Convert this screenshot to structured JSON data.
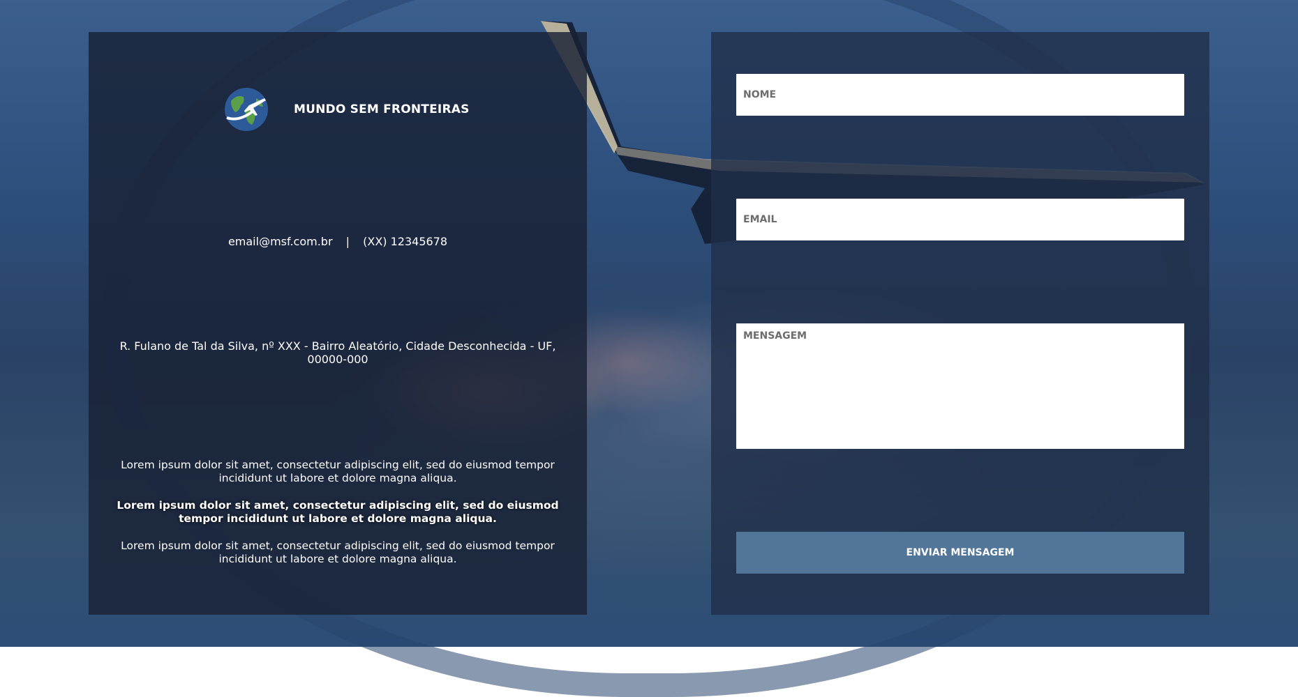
{
  "brand": {
    "name": "MUNDO SEM FRONTEIRAS",
    "logo_icon": "globe-airplane-icon"
  },
  "contact": {
    "email": "email@msf.com.br",
    "separator": "|",
    "phone": "(XX) 12345678",
    "address": "R. Fulano de Tal da Silva, nº XXX - Bairro Aleatório, Cidade Desconhecida - UF, 00000-000"
  },
  "about": {
    "paragraphs": [
      "Lorem ipsum dolor sit amet, consectetur adipiscing elit, sed do eiusmod tempor incididunt ut labore et dolore magna aliqua.",
      "Lorem ipsum dolor sit amet, consectetur adipiscing elit, sed do eiusmod tempor incididunt ut labore et dolore magna aliqua.",
      "Lorem ipsum dolor sit amet, consectetur adipiscing elit, sed do eiusmod tempor incididunt ut labore et dolore magna aliqua."
    ]
  },
  "form": {
    "name_placeholder": "NOME",
    "email_placeholder": "EMAIL",
    "message_placeholder": "MENSAGEM",
    "submit_label": "ENVIAR MENSAGEM"
  },
  "colors": {
    "panel_bg": "#182134",
    "button_bg": "#527699",
    "text": "#ffffff"
  }
}
